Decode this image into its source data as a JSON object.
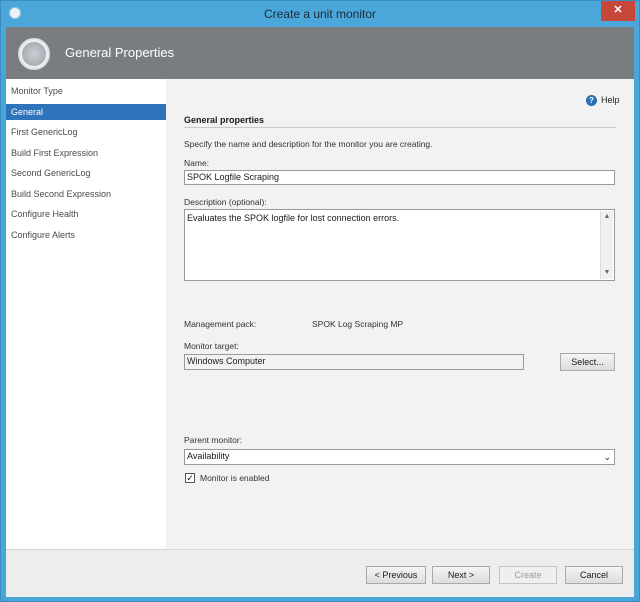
{
  "window": {
    "title": "Create a unit monitor",
    "close_icon": "close-icon"
  },
  "banner": {
    "title": "General Properties",
    "icon": "monitor-wizard-icon"
  },
  "nav": {
    "items": [
      {
        "label": "Monitor Type",
        "active": false
      },
      {
        "label": "General",
        "active": true
      },
      {
        "label": "First GenericLog",
        "active": false
      },
      {
        "label": "Build First Expression",
        "active": false
      },
      {
        "label": "Second GenericLog",
        "active": false
      },
      {
        "label": "Build Second Expression",
        "active": false
      },
      {
        "label": "Configure Health",
        "active": false
      },
      {
        "label": "Configure Alerts",
        "active": false
      }
    ]
  },
  "main": {
    "help_label": "Help",
    "section_title": "General properties",
    "intro": "Specify the name and description for the monitor you are creating.",
    "name_label": "Name:",
    "name_value": "SPOK Logfile Scraping",
    "description_label": "Description (optional):",
    "description_value": "Evaluates the SPOK logfile for lost connection errors.",
    "management_pack_label": "Management pack:",
    "management_pack_value": "SPOK Log Scraping MP",
    "monitor_target_label": "Monitor target:",
    "monitor_target_value": "Windows Computer",
    "select_button": "Select...",
    "parent_monitor_label": "Parent monitor:",
    "parent_monitor_value": "Availability",
    "monitor_enabled_label": "Monitor is enabled",
    "monitor_enabled_checked": true
  },
  "footer": {
    "previous": "< Previous",
    "next": "Next >",
    "create": "Create",
    "cancel": "Cancel"
  }
}
